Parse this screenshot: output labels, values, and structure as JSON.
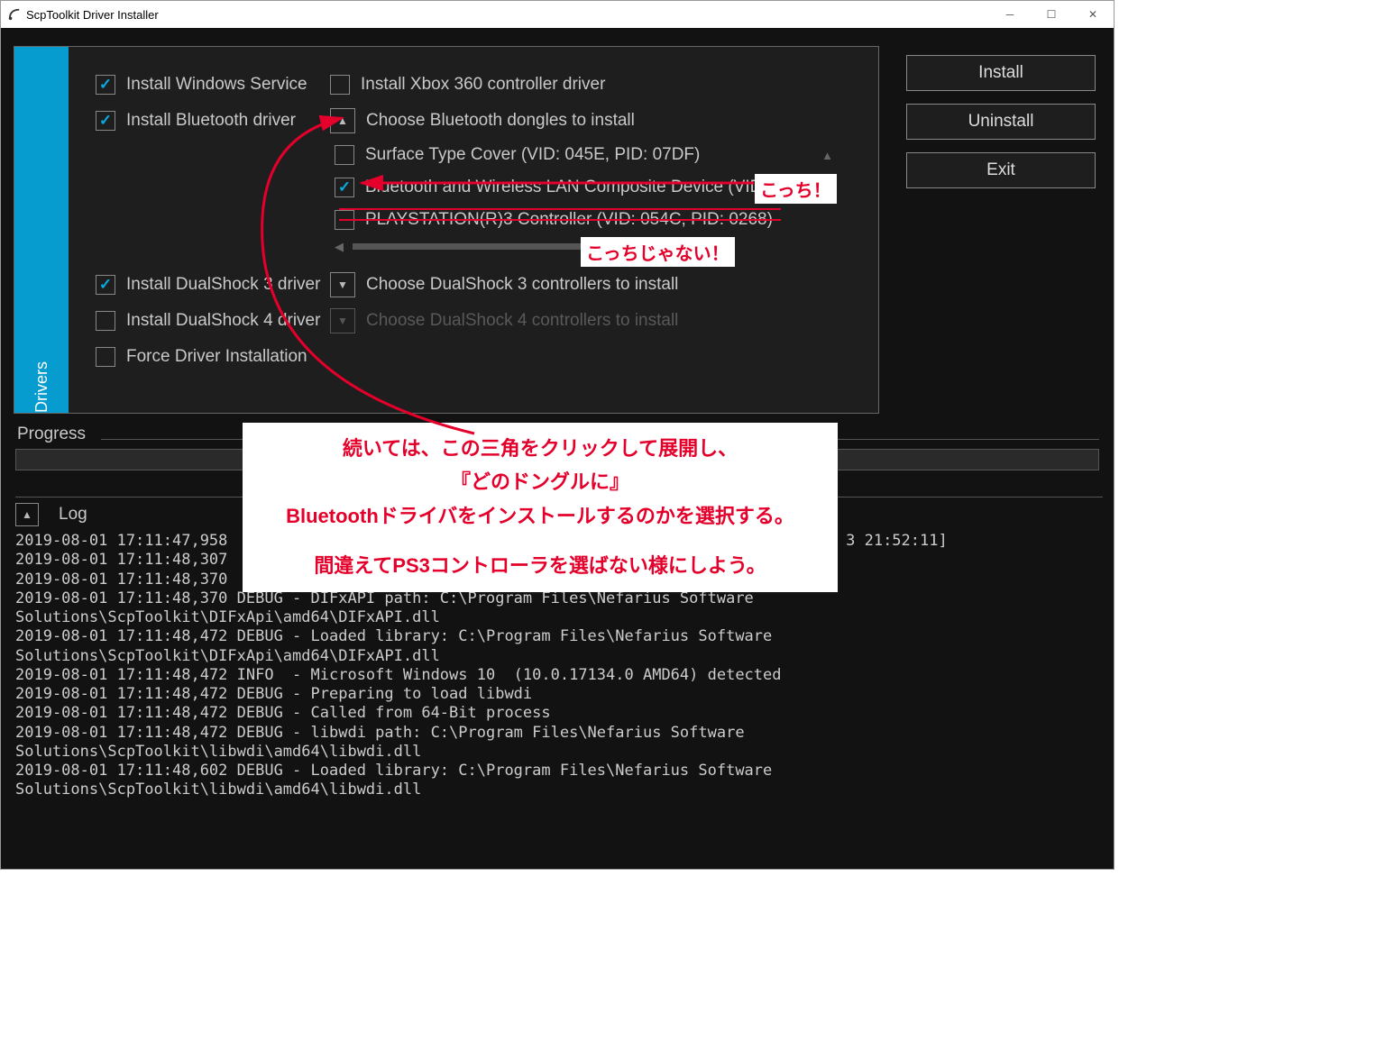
{
  "window": {
    "title": "ScpToolkit Driver Installer"
  },
  "tab": {
    "label": "Drivers"
  },
  "checkboxes": {
    "winservice": "Install Windows Service",
    "xbox360": "Install Xbox 360 controller driver",
    "bluetooth": "Install Bluetooth driver",
    "ds3": "Install DualShock 3 driver",
    "ds4": "Install DualShock 4 driver",
    "force": "Force Driver Installation"
  },
  "btgroup": {
    "header": "Choose Bluetooth dongles to install",
    "items": [
      "Surface Type Cover (VID: 045E, PID: 07DF)",
      "Bluetooth and Wireless LAN Composite Device (VID",
      "PLAYSTATION(R)3 Controller (VID: 054C, PID: 0268)"
    ]
  },
  "ds3group": {
    "header": "Choose DualShock 3 controllers to install"
  },
  "ds4group": {
    "header": "Choose DualShock 4 controllers to install"
  },
  "buttons": {
    "install": "Install",
    "uninstall": "Uninstall",
    "exit": "Exit"
  },
  "progress": {
    "label": "Progress"
  },
  "log": {
    "label": "Log",
    "text": "2019-08-01 17:11:47,958                                                                   3 21:52:11]\n2019-08-01 17:11:48,307\n2019-08-01 17:11:48,370\n2019-08-01 17:11:48,370 DEBUG - DIFxAPI path: C:\\Program Files\\Nefarius Software Solutions\\ScpToolkit\\DIFxApi\\amd64\\DIFxAPI.dll\n2019-08-01 17:11:48,472 DEBUG - Loaded library: C:\\Program Files\\Nefarius Software Solutions\\ScpToolkit\\DIFxApi\\amd64\\DIFxAPI.dll\n2019-08-01 17:11:48,472 INFO  - Microsoft Windows 10  (10.0.17134.0 AMD64) detected\n2019-08-01 17:11:48,472 DEBUG - Preparing to load libwdi\n2019-08-01 17:11:48,472 DEBUG - Called from 64-Bit process\n2019-08-01 17:11:48,472 DEBUG - libwdi path: C:\\Program Files\\Nefarius Software Solutions\\ScpToolkit\\libwdi\\amd64\\libwdi.dll\n2019-08-01 17:11:48,602 DEBUG - Loaded library: C:\\Program Files\\Nefarius Software Solutions\\ScpToolkit\\libwdi\\amd64\\libwdi.dll"
  },
  "annotations": {
    "kocchi": "こっち！",
    "janai": "こっちじゃない！",
    "big1": "続いては、この三角をクリックして展開し、",
    "big2": "『どのドングルに』",
    "big3": "Bluetoothドライバをインストールするのかを選択する。",
    "big4": "間違えてPS3コントローラを選ばない様にしよう。"
  }
}
